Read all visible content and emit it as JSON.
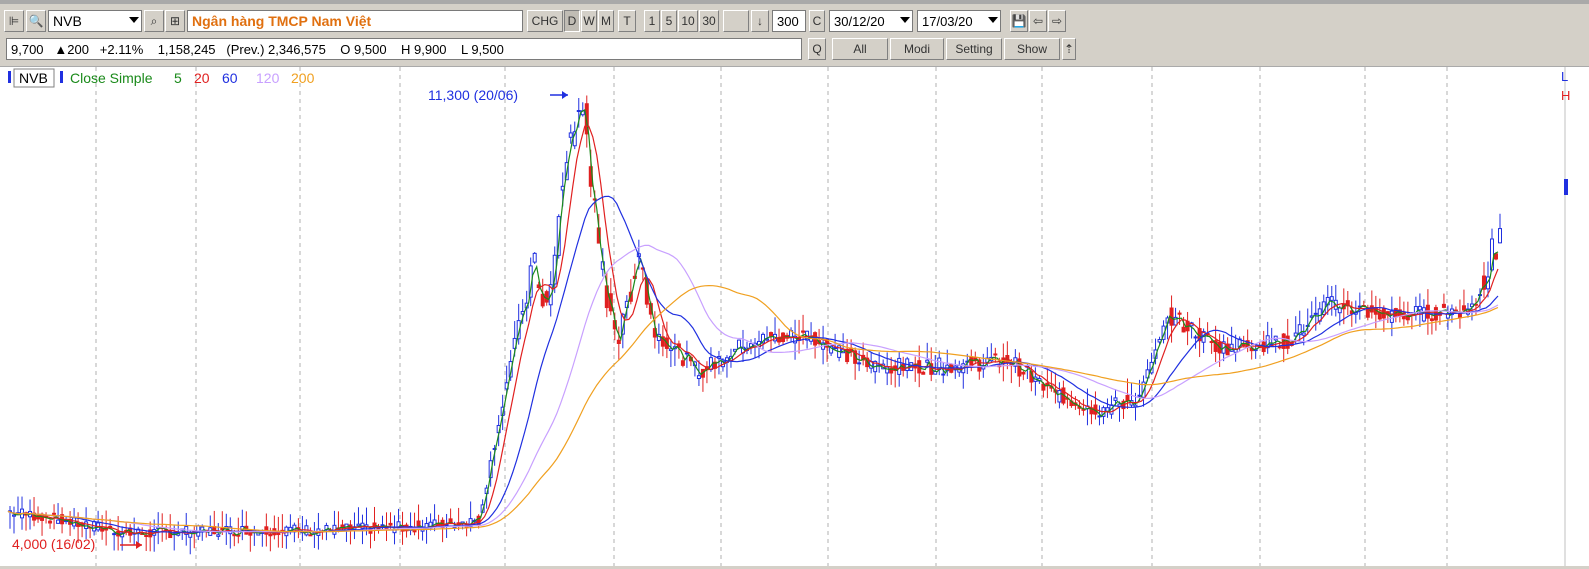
{
  "toolbar": {
    "symbol": "NVB",
    "company": "Ngân hàng TMCP Nam Việt",
    "chg": "CHG",
    "periods": [
      "D",
      "W",
      "M",
      "T"
    ],
    "intervals": [
      "1",
      "5",
      "10",
      "30"
    ],
    "count": "300",
    "c_label": "C",
    "date_from": "30/12/20",
    "date_to": "17/03/20"
  },
  "quote": {
    "summary": "9,700   ▲200   +2.11%    1,158,245   (Prev.) 2,346,575    O 9,500    H 9,900    L 9,500",
    "q_label": "Q",
    "buttons": [
      "All",
      "Modi",
      "Setting",
      "Show"
    ]
  },
  "chart_data": {
    "type": "candlestick",
    "symbol_label": "NVB",
    "indicator_label": "Close Simple",
    "ma_periods": [
      "5",
      "20",
      "60",
      "120",
      "200"
    ],
    "ma_colors": [
      "#1a8a1a",
      "#e02020",
      "#2030e0",
      "#c8a0ff",
      "#f0a020"
    ],
    "up_color": "#2030e0",
    "down_color": "#e02020",
    "high_annotation": "11,300 (20/06)",
    "low_annotation": "4,000 (16/02)",
    "high_value": 11300,
    "low_value": 4000,
    "right_labels": [
      "L",
      "H"
    ]
  }
}
